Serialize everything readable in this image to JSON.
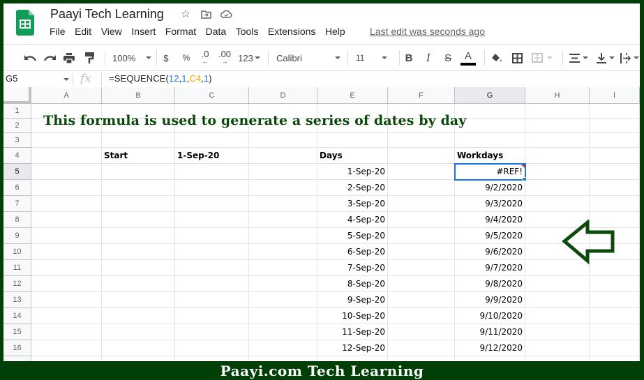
{
  "app": {
    "title": "Paayi Tech Learning",
    "brand_color": "#0f9d58",
    "title_icons": [
      "star-icon",
      "move-to-folder-icon",
      "cloud-status-icon"
    ],
    "menu": [
      "File",
      "Edit",
      "View",
      "Insert",
      "Format",
      "Data",
      "Tools",
      "Extensions",
      "Help"
    ],
    "last_edit": "Last edit was seconds ago"
  },
  "toolbar": {
    "zoom": "100%",
    "currency": "$",
    "percent": "%",
    "decrease_decimal": ".0",
    "increase_decimal": ".00",
    "more_formats": "123",
    "font": "Calibri",
    "font_size": "11",
    "bold": "B",
    "italic": "I",
    "strikethrough": "S",
    "text_color": "A"
  },
  "formula_bar": {
    "name_box": "G5",
    "fx": "fx",
    "formula_parts": [
      "=SEQUENCE(",
      "12",
      ",",
      "1",
      ",",
      "C4",
      ",",
      "1",
      ")"
    ]
  },
  "sheet": {
    "columns": [
      "A",
      "B",
      "C",
      "D",
      "E",
      "F",
      "G",
      "H",
      "I"
    ],
    "selected_column": "G",
    "rows": [
      "1",
      "2",
      "3",
      "4",
      "5",
      "6",
      "7",
      "8",
      "9",
      "10",
      "11",
      "12",
      "13",
      "14",
      "15",
      "16"
    ],
    "selected_row": "5",
    "headline": "This formula is used to generate a series of dates by day",
    "headline_color": "#0b4a0b",
    "labels": {
      "start": "Start",
      "start_value": "1-Sep-20",
      "days": "Days",
      "workdays": "Workdays"
    },
    "days": [
      "1-Sep-20",
      "2-Sep-20",
      "3-Sep-20",
      "4-Sep-20",
      "5-Sep-20",
      "6-Sep-20",
      "7-Sep-20",
      "8-Sep-20",
      "9-Sep-20",
      "10-Sep-20",
      "11-Sep-20",
      "12-Sep-20"
    ],
    "workdays": [
      "#REF!",
      "9/2/2020",
      "9/3/2020",
      "9/4/2020",
      "9/5/2020",
      "9/6/2020",
      "9/7/2020",
      "9/8/2020",
      "9/9/2020",
      "9/10/2020",
      "9/11/2020",
      "9/12/2020"
    ],
    "active_cell": "G5"
  },
  "annotation": {
    "arrow": "left-arrow-icon",
    "color": "#0b4a0b"
  },
  "banner": {
    "text": "Paayi.com Tech Learning",
    "color": "#003f06"
  }
}
